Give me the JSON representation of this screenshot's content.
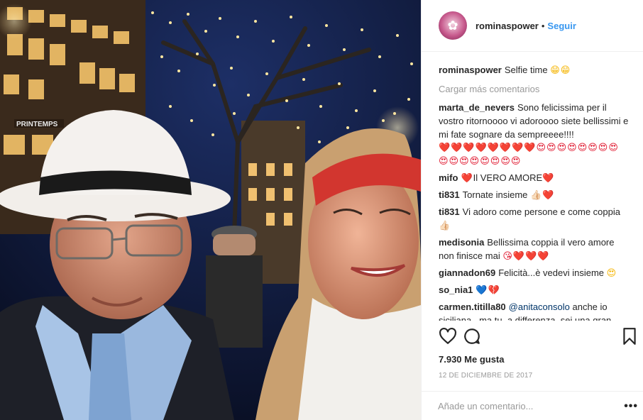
{
  "post": {
    "author": "rominaspower",
    "follow_label": "Seguir",
    "separator": "•",
    "caption_text": "Selfie time",
    "caption_emoji": "😁😁",
    "load_more": "Cargar más comentarios",
    "likes": "7.930 Me gusta",
    "date": "12 DE DICIEMBRE DE 2017",
    "add_comment_placeholder": "Añade un comentario...",
    "options_glyph": "•••"
  },
  "comments": [
    {
      "user": "marta_de_nevers",
      "text": "Sono felicissima per il vostro ritornoooo vi adoroooo siete bellissimi e mi fate sognare da sempreeee!!!!",
      "emoji": "❤️❤️❤️❤️❤️❤️❤️❤️😍😍😍😍😍😍😍😍😍😍😍😍😍😍😍😍"
    },
    {
      "user": "mifo",
      "text": "Il VERO AMORE",
      "emoji_before": "❤️",
      "emoji": "❤️"
    },
    {
      "user": "ti831",
      "text": "Tornate insieme",
      "emoji": "👍🏻❤️"
    },
    {
      "user": "ti831",
      "text": "Vi adoro come persone e come coppia",
      "emoji": "👍🏻"
    },
    {
      "user": "medisonia",
      "text": "Bellissima coppia il vero amore non finisce mai",
      "emoji": "😘❤️❤️❤️"
    },
    {
      "user": "giannadon69",
      "text": "Felicità...è vedevi insieme",
      "emoji": "😍"
    },
    {
      "user": "so_nia1",
      "text": "",
      "emoji": "💙💔"
    },
    {
      "user": "carmen.titilla80",
      "mention": "@anitaconsolo",
      "text": "anche io siciliana...ma tu, a differenza, sei una gran"
    }
  ],
  "icons": {
    "like": "heart-outline-icon",
    "comment": "speech-bubble-icon",
    "save": "bookmark-icon"
  },
  "colors": {
    "link_blue": "#3897f0",
    "text": "#262626",
    "muted": "#999999",
    "divider": "#efefef"
  }
}
